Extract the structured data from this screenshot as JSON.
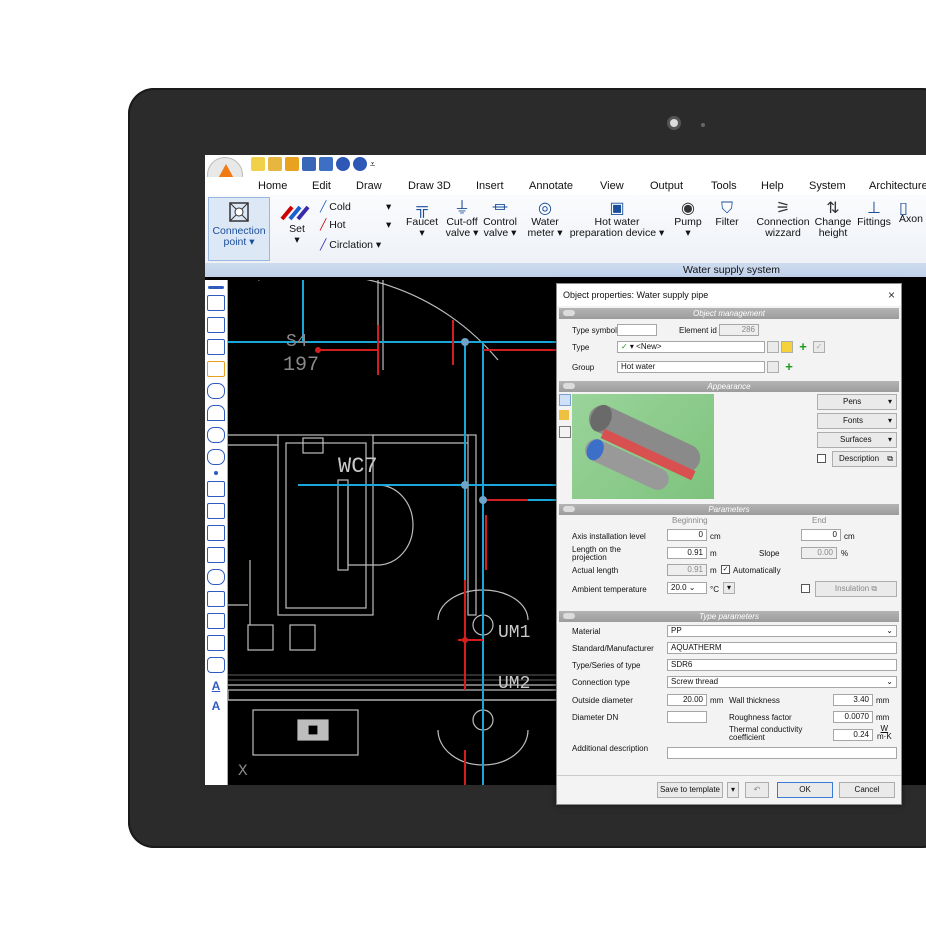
{
  "qat": {
    "icons": [
      "new-file-icon",
      "open-folder-icon",
      "wand-icon",
      "save-icon",
      "print-preview-icon",
      "undo-icon",
      "redo-icon",
      "dropdown-icon"
    ]
  },
  "menu": [
    "Home",
    "Edit",
    "Draw",
    "Draw 3D",
    "Insert",
    "Annotate",
    "View",
    "Output",
    "Tools",
    "Help",
    "System",
    "Architecture"
  ],
  "ribbon": {
    "connection_point": "Connection\npoint ▾",
    "set": "Set\n▾",
    "cold": "Cold",
    "hot": "Hot",
    "circulation": "Circlation ▾",
    "faucet": "Faucet\n▾",
    "cutoff": "Cut-off\nvalve ▾",
    "control": "Control\nvalve ▾",
    "water_meter": "Water\nmeter ▾",
    "hot_water": "Hot water\npreparation device ▾",
    "pump": "Pump\n▾",
    "filter": "Filter",
    "conn_wizard": "Connection\nwizzard",
    "change_height": "Change\nheight",
    "fittings": "Fittings",
    "axon": "Axon"
  },
  "group_label": "Water supply system",
  "drawing_labels": {
    "room": "WC7",
    "um1": "UM1",
    "um2": "UM2",
    "dim1": "197",
    "dim2": "S4",
    "x": "X"
  },
  "dialog": {
    "title": "Object properties: Water supply pipe",
    "close": "×",
    "sections": {
      "mgmt": "Object management",
      "appearance": "Appearance",
      "parameters": "Parameters",
      "type_params": "Type parameters"
    },
    "mgmt": {
      "type_symbol_label": "Type symbol",
      "element_id_label": "Element id",
      "element_id": "286",
      "type_label": "Type",
      "type_value": "<New>",
      "group_label": "Group",
      "group_value": "Hot water"
    },
    "appearance": {
      "pens": "Pens",
      "fonts": "Fonts",
      "surfaces": "Surfaces",
      "description": "Description"
    },
    "params": {
      "beginning": "Beginning",
      "end": "End",
      "axis_label": "Axis installation level",
      "axis_begin": "0",
      "axis_end": "0",
      "cm": "cm",
      "length_label": "Length on the projection",
      "length": "0.91",
      "m": "m",
      "slope_label": "Slope",
      "slope": "0.00",
      "pct": "%",
      "actual_label": "Actual length",
      "actual": "0.91",
      "auto": "Automatically",
      "ambient_label": "Ambient temperature",
      "ambient": "20.0",
      "degc": "°C",
      "insulation": "Insulation"
    },
    "type_params": {
      "material_label": "Material",
      "material": "PP",
      "std_label": "Standard/Manufacturer",
      "std": "AQUATHERM",
      "series_label": "Type/Series of type",
      "series": "SDR6",
      "conn_label": "Connection type",
      "conn": "Screw thread",
      "od_label": "Outside diameter",
      "od": "20.00",
      "mm": "mm",
      "wall_label": "Wall thickness",
      "wall": "3.40",
      "dn_label": "Diameter DN",
      "rough_label": "Roughness factor",
      "rough": "0.0070",
      "therm_label": "Thermal conductivity coefficient",
      "therm": "0.24",
      "therm_unit_top": "W",
      "therm_unit_bot": "m·K",
      "add_label": "Additional description"
    },
    "footer": {
      "save_template": "Save to template",
      "ok": "OK",
      "cancel": "Cancel"
    }
  }
}
